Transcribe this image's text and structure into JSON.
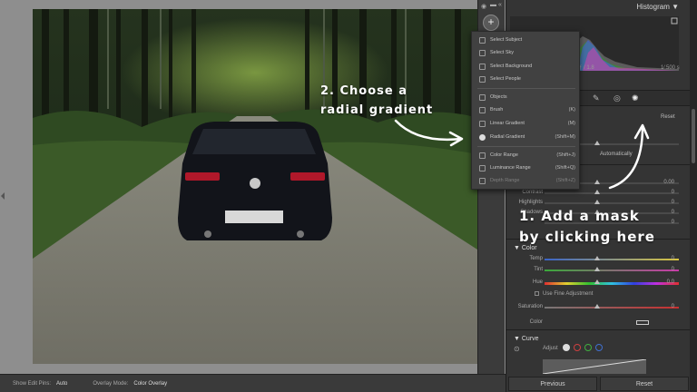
{
  "photo": {
    "description_icon": "car-photo"
  },
  "bottom_bar": {
    "show_edit_pins_label": "Show Edit Pins:",
    "show_edit_pins_value": "Auto",
    "overlay_mode_label": "Overlay Mode:",
    "overlay_mode_value": "Color Overlay"
  },
  "mask_strip": {
    "add_button": "+"
  },
  "histogram": {
    "title": "Histogram",
    "readout_mid": "ƒ / 1.8",
    "readout_right": "1⁄ 500 s"
  },
  "mask_menu": {
    "items": [
      {
        "label": "Select Subject",
        "shortcut": "",
        "dim": false
      },
      {
        "label": "Select Sky",
        "shortcut": "",
        "dim": false
      },
      {
        "label": "Select Background",
        "shortcut": "",
        "dim": false
      },
      {
        "label": "Select People",
        "shortcut": "",
        "dim": false
      },
      {
        "label": "Objects",
        "shortcut": "",
        "dim": false
      },
      {
        "label": "Brush",
        "shortcut": "(K)",
        "dim": false
      },
      {
        "label": "Linear Gradient",
        "shortcut": "(M)",
        "dim": false
      },
      {
        "label": "Radial Gradient",
        "shortcut": "(Shift+M)",
        "dim": false
      },
      {
        "label": "Color Range",
        "shortcut": "(Shift+J)",
        "dim": false
      },
      {
        "label": "Luminance Range",
        "shortcut": "(Shift+Q)",
        "dim": false
      },
      {
        "label": "Depth Range",
        "shortcut": "(Shift+Z)",
        "dim": true
      }
    ]
  },
  "panel": {
    "reset_label": "Reset",
    "auto_label": "Automatically",
    "light_rows": [
      {
        "label": "Contrast",
        "value": "0"
      },
      {
        "label": "Highlights",
        "value": "0"
      },
      {
        "label": "Shadows",
        "value": "0"
      },
      {
        "label": "",
        "value": "0"
      }
    ],
    "exposure_value": "0.00",
    "color_section": "Color",
    "color_rows": [
      {
        "label": "Temp",
        "value": "0"
      },
      {
        "label": "Tint",
        "value": "0"
      },
      {
        "label": "Hue",
        "value": "0.0"
      }
    ],
    "fine_adjust": "Use Fine Adjustment",
    "saturation": {
      "label": "Saturation",
      "value": "0"
    },
    "color_label": "Color",
    "curve_section": "Curve",
    "adjust_label": "Adjust",
    "previous_button": "Previous",
    "reset_button": "Reset"
  },
  "annotations": {
    "step2_line1": "2. Choose a",
    "step2_line2": "radial gradient",
    "step1_line1": "1. Add a mask",
    "step1_line2": "by clicking here"
  },
  "colors": {
    "panel_bg": "#343434",
    "canvas_bg": "#8e8e8e",
    "annotation": "#ffffff"
  }
}
